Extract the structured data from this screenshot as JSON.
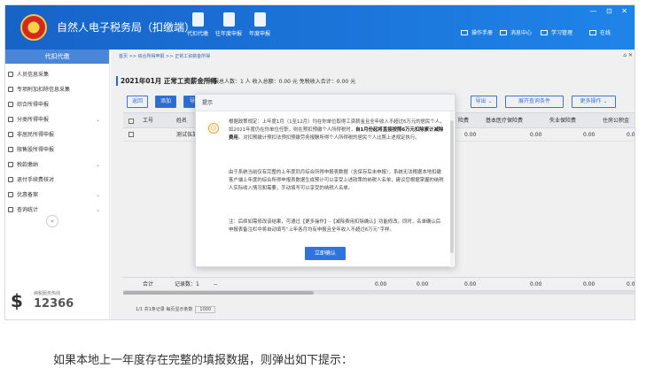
{
  "topbar": {
    "app_title": "自然人电子税务局（扣缴端）",
    "tools": [
      {
        "icon": "gear-icon",
        "label": "代扣代缴"
      },
      {
        "icon": "document-gear-icon",
        "label": "往年度申报"
      },
      {
        "icon": "calendar-icon",
        "label": "年度申报"
      }
    ],
    "right_items": [
      {
        "icon": "manual-icon",
        "label": "操作手册"
      },
      {
        "icon": "message-icon",
        "label": "消息中心"
      },
      {
        "icon": "study-icon",
        "label": "学习管理"
      },
      {
        "icon": "online-icon",
        "label": "在线"
      }
    ],
    "window_controls": "— ⊡ ✕"
  },
  "sidebar": {
    "header": "代扣代缴",
    "items": [
      {
        "icon": "person-icon",
        "label": "人员信息采集",
        "chevron": ""
      },
      {
        "icon": "list-icon",
        "label": "专项附加扣除信息采集",
        "chevron": ""
      },
      {
        "icon": "settings-icon",
        "label": "综合所得申报",
        "chevron": ""
      },
      {
        "icon": "clock-icon",
        "label": "分类所得申报",
        "chevron": "⌄"
      },
      {
        "icon": "user-icon",
        "label": "非居民所得申报",
        "chevron": ""
      },
      {
        "icon": "chart-icon",
        "label": "限售股所得申报",
        "chevron": ""
      },
      {
        "icon": "tax-icon",
        "label": "税款缴纳",
        "chevron": "⌄"
      },
      {
        "icon": "refund-icon",
        "label": "退付手续费核对",
        "chevron": ""
      },
      {
        "icon": "discount-icon",
        "label": "优惠备案",
        "chevron": "⌄"
      },
      {
        "icon": "stats-icon",
        "label": "查询统计",
        "chevron": "⌄"
      }
    ],
    "collapse": "«",
    "hotline_label": "纳税服务热线",
    "hotline_number": "12366"
  },
  "main": {
    "breadcrumb": "首页 >> 综合所得申报 >> 正常工资薪金所得",
    "close": "⌂ ✕",
    "title": "2021年01月 正常工资薪金所得",
    "summary": "申报总人数：1 人  收入总额：0.00 元  免税收入合计：0.00 元",
    "buttons": {
      "back": "返回",
      "add": "添加",
      "import": "导",
      "export": "导出 ⌄",
      "expand": "展开查询条件",
      "more": "更多操作 ⌄"
    },
    "columns": [
      "工号",
      "姓名",
      "...",
      "...",
      "险费",
      "基本医疗保险费",
      "失业保险费",
      "住房公积金"
    ],
    "row": {
      "job_no": "",
      "name": "测试伍某",
      "c1": "0.00",
      "c2": "0.00",
      "c3": "0.00",
      "c4": "0.0"
    },
    "footer": {
      "total": "合计",
      "records": "记录数：1",
      "dash": "--",
      "v1": "0.00",
      "v2": "0.00",
      "v3": "0.00",
      "v4": "0.00",
      "v5": "0.00",
      "v6": "0.0"
    },
    "pager": {
      "info": "1/1 共1条记录 每页显示条数",
      "size": "1000"
    }
  },
  "modal": {
    "title": "提示",
    "para1_a": "根据政策规定：上年度1月（1至12月）均在你单位取得工资薪金且全年收入不超过6万元的居民个人，如2021年度仍在你单位任职，则在预扣预缴个人所得税时，",
    "para1_b": "自1月份起将直接按照6万元扣除累计减除费用",
    "para1_c": "。对扣预缴计预扣法预扣预缴劳务报酬所得个人所得税的居民个人比照上述规定执行。",
    "para2": "由于系统当前仅有完整的上年度同月综合所得申报表数据（含保存后未申报），系统无法根据本地扣缴客户端上年度的综合所得申报表数据生成预计可以享受上述政策的纳税人名单，建议您根据掌握的纳税人实际收入情况和需要，手动填写可以享受的纳税人名单。",
    "para3": "注：后续如需修改该结果，可通过【更多操作】-【减除费用扣除确认】功能修改。同时，名单确认后申报表备注栏中将自动填写“上年各月均有申报且全年收入不超过6万元”字样。",
    "confirm": "立即确认"
  },
  "caption": "如果本地上一年度存在完整的填报数据，则弹出如下提示："
}
